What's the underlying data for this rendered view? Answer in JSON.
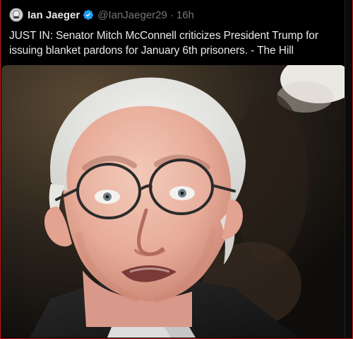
{
  "tweet": {
    "author_name": "Ian Jaeger",
    "author_handle": "@IanJaeger29",
    "separator": "·",
    "timestamp": "16h",
    "text": "JUST IN: Senator Mitch McConnell criticizes President Trump for issuing blanket pardons for January 6th prisoners. - The Hill"
  },
  "icons": {
    "avatar": "avatar-icon",
    "verified": "verified-badge-icon"
  },
  "colors": {
    "background": "#000000",
    "text": "#e7e9ea",
    "muted": "#71767b",
    "verified": "#1d9bf0",
    "border": "#cc1f1f"
  }
}
